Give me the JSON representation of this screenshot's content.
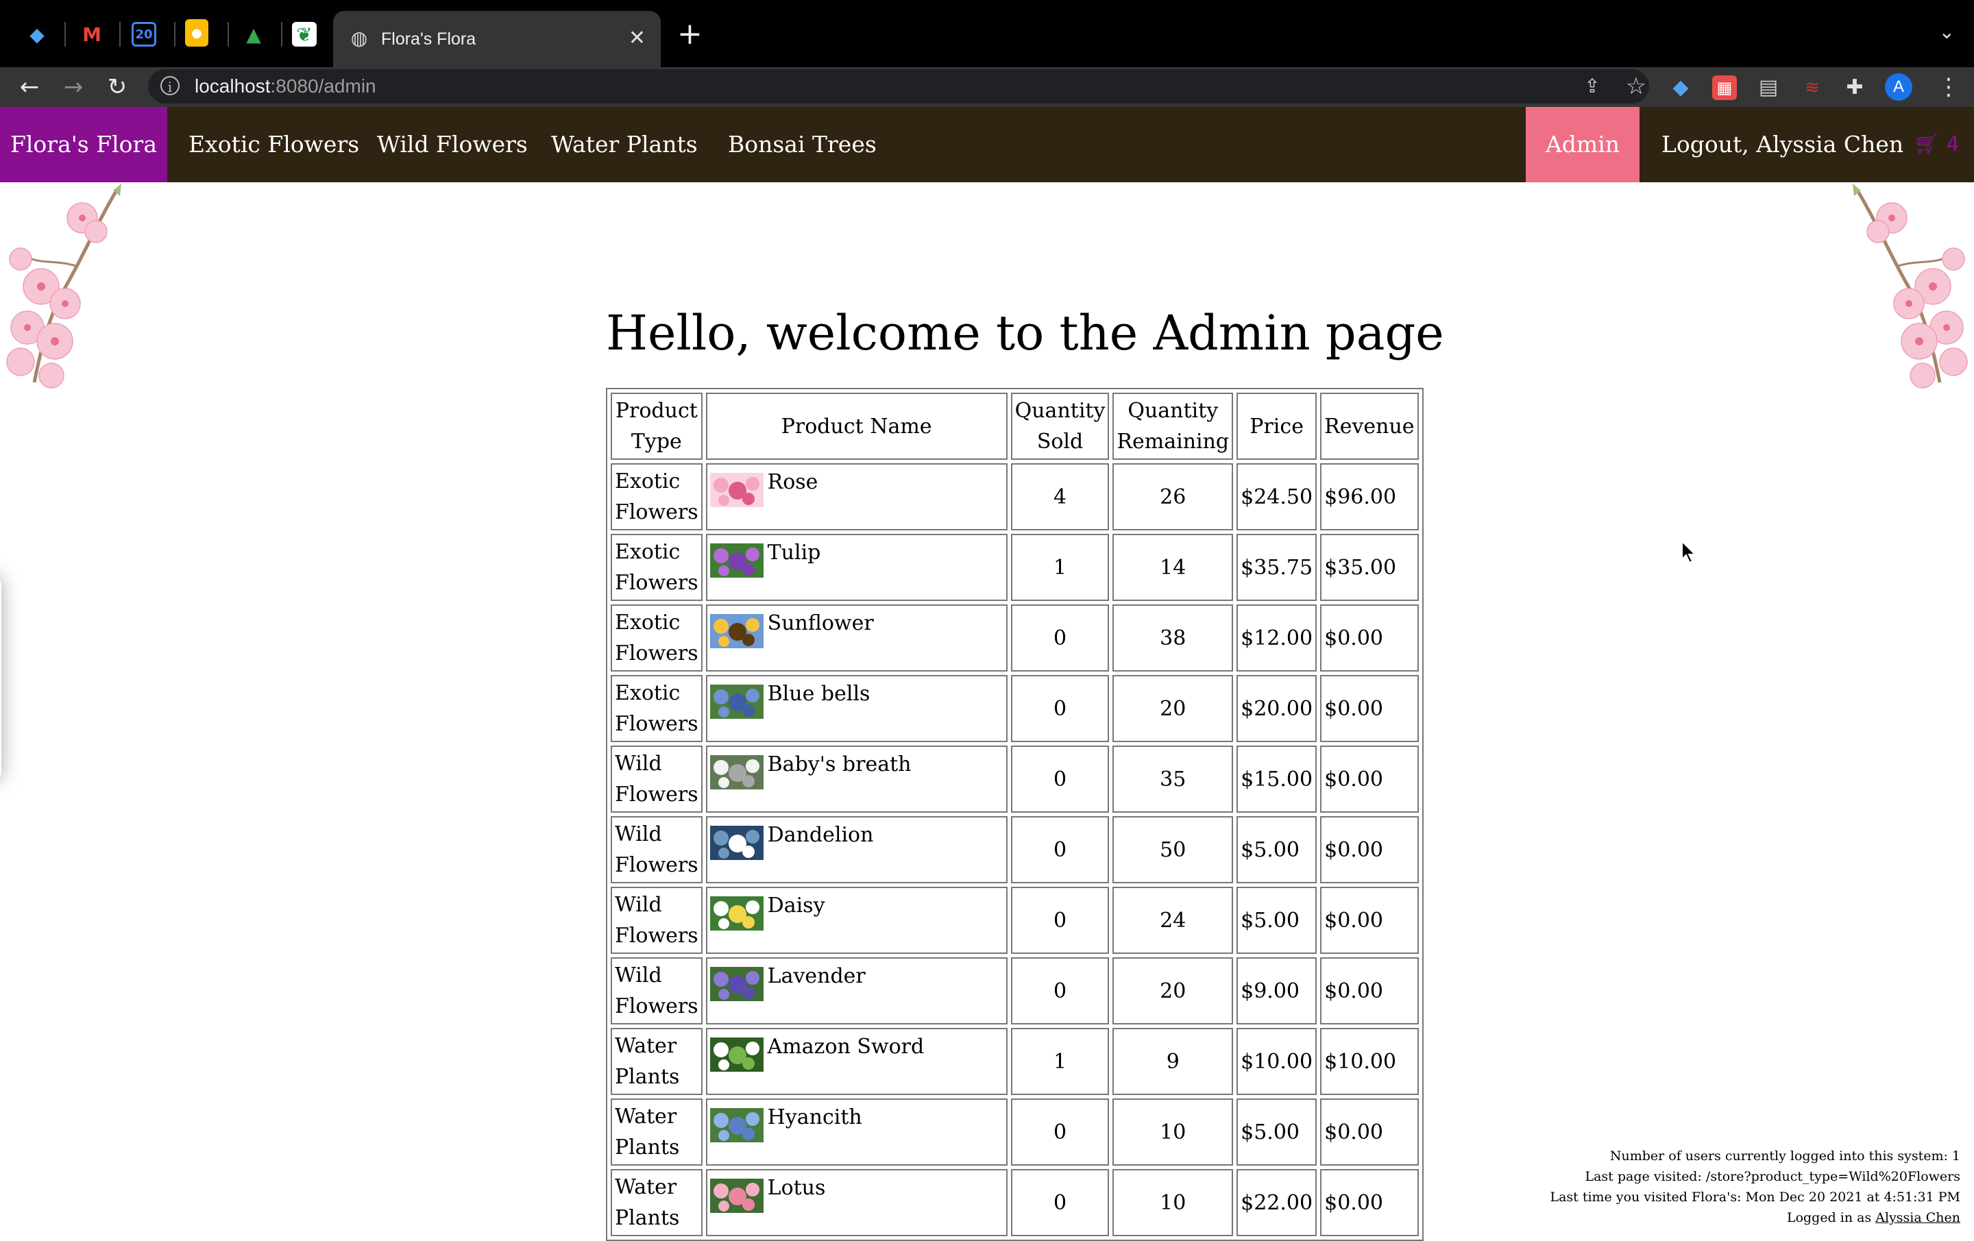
{
  "browser": {
    "tab_title": "Flora's Flora",
    "close_glyph": "✕",
    "new_tab_glyph": "+",
    "tab_list_glyph": "⌄",
    "url_host": "localhost",
    "url_path": ":8080/admin",
    "back_glyph": "←",
    "forward_glyph": "→",
    "reload_glyph": "↻",
    "info_glyph": "i",
    "share_glyph": "⇪",
    "star_glyph": "☆",
    "puzzle_glyph": "✚",
    "menu_glyph": "⋮",
    "avatar_letter": "A",
    "pinned_tabs": [
      {
        "icon": "diamond-icon",
        "glyph": "◆",
        "color": "#4fa3f0"
      },
      {
        "icon": "gmail-icon",
        "glyph": "M",
        "color": "#ea4335"
      },
      {
        "icon": "calendar-icon",
        "glyph": "20",
        "color": "#4285f4"
      },
      {
        "icon": "keep-icon",
        "glyph": "●",
        "color": "#fbbc04"
      },
      {
        "icon": "drive-icon",
        "glyph": "▲",
        "color": "#34a853"
      },
      {
        "icon": "leaf-icon",
        "glyph": "❦",
        "color": "#1e8e3e"
      }
    ]
  },
  "nav": {
    "brand": "Flora's Flora",
    "links": [
      "Exotic Flowers",
      "Wild Flowers",
      "Water Plants",
      "Bonsai Trees"
    ],
    "admin": "Admin",
    "logout": "Logout, Alyssia Chen",
    "cart_count": "4",
    "cart_icon": "cart-icon",
    "brand_color": "#880f8f",
    "nav_bg": "#2f2411",
    "admin_color": "#ee6f86"
  },
  "main": {
    "heading": "Hello, welcome to the Admin page",
    "columns": [
      "Product Type",
      "Product Name",
      "Quantity Sold",
      "Quantity Remaining",
      "Price",
      "Revenue"
    ],
    "rows": [
      {
        "type": "Exotic Flowers",
        "name": "Rose",
        "sold": "4",
        "remaining": "26",
        "price": "$24.50",
        "revenue": "$96.00"
      },
      {
        "type": "Exotic Flowers",
        "name": "Tulip",
        "sold": "1",
        "remaining": "14",
        "price": "$35.75",
        "revenue": "$35.00"
      },
      {
        "type": "Exotic Flowers",
        "name": "Sunflower",
        "sold": "0",
        "remaining": "38",
        "price": "$12.00",
        "revenue": "$0.00"
      },
      {
        "type": "Exotic Flowers",
        "name": "Blue bells",
        "sold": "0",
        "remaining": "20",
        "price": "$20.00",
        "revenue": "$0.00"
      },
      {
        "type": "Wild Flowers",
        "name": "Baby's breath",
        "sold": "0",
        "remaining": "35",
        "price": "$15.00",
        "revenue": "$0.00"
      },
      {
        "type": "Wild Flowers",
        "name": "Dandelion",
        "sold": "0",
        "remaining": "50",
        "price": "$5.00",
        "revenue": "$0.00"
      },
      {
        "type": "Wild Flowers",
        "name": "Daisy",
        "sold": "0",
        "remaining": "24",
        "price": "$5.00",
        "revenue": "$0.00"
      },
      {
        "type": "Wild Flowers",
        "name": "Lavender",
        "sold": "0",
        "remaining": "20",
        "price": "$9.00",
        "revenue": "$0.00"
      },
      {
        "type": "Water Plants",
        "name": "Amazon Sword",
        "sold": "1",
        "remaining": "9",
        "price": "$10.00",
        "revenue": "$10.00"
      },
      {
        "type": "Water Plants",
        "name": "Hyancith",
        "sold": "0",
        "remaining": "10",
        "price": "$5.00",
        "revenue": "$0.00"
      },
      {
        "type": "Water Plants",
        "name": "Lotus",
        "sold": "0",
        "remaining": "10",
        "price": "$22.00",
        "revenue": "$0.00"
      }
    ]
  },
  "footer": {
    "users_line": "Number of users currently logged into this system: 1",
    "last_page_line": "Last page visited: /store?product_type=Wild%20Flowers",
    "last_visit_line": "Last time you visited Flora's: Mon Dec 20 2021 at 4:51:31 PM",
    "logged_in_prefix": "Logged in as ",
    "logged_in_user": "Alyssia Chen"
  }
}
